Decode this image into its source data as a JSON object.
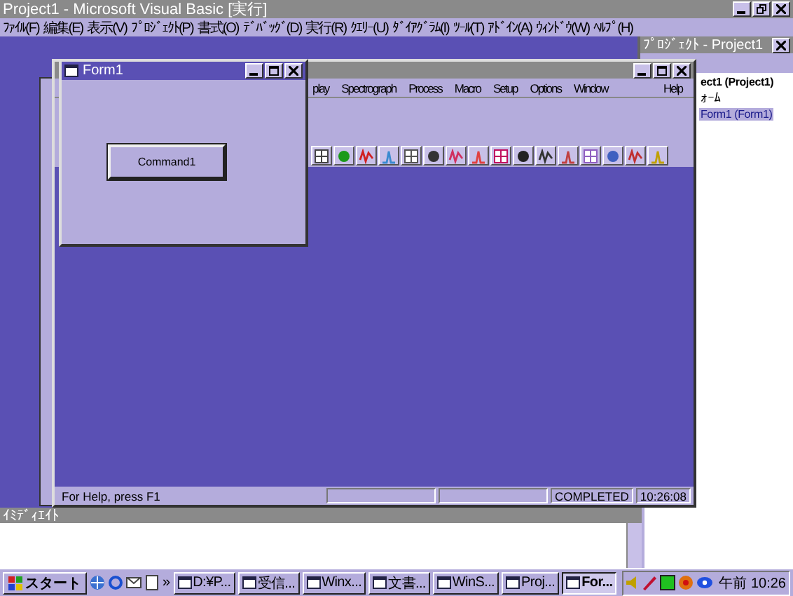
{
  "main_window": {
    "title": "Project1 - Microsoft Visual Basic [実行]",
    "menu": [
      "ﾌｧｲﾙ(F)",
      "編集(E)",
      "表示(V)",
      "ﾌﾟﾛｼﾞｪｸﾄ(P)",
      "書式(O)",
      "ﾃﾞﾊﾞｯｸﾞ(D)",
      "実行(R)",
      "ｸｴﾘｰ(U)",
      "ﾀﾞｲｱｸﾞﾗﾑ(I)",
      "ﾂｰﾙ(T)",
      "ｱﾄﾞｲﾝ(A)",
      "ｳｨﾝﾄﾞｳ(W)",
      "ﾍﾙﾌﾟ(H)"
    ]
  },
  "project_explorer": {
    "title": "ﾌﾟﾛｼﾞｪｸﾄ - Project1",
    "tree": [
      {
        "label": "ect1 (Project1)",
        "selected": false,
        "children": [
          {
            "label": "ｫｰﾑ",
            "selected": false,
            "children": [
              {
                "label": "Form1 (Form1)",
                "selected": true
              }
            ]
          }
        ]
      }
    ]
  },
  "app_window": {
    "menu": [
      "play",
      "Spectrograph",
      "Process",
      "Macro",
      "Setup",
      "Options",
      "Window"
    ],
    "help_menu": "Help",
    "status_bar": [
      "For Help, press F1",
      "COMPLETED",
      "10:26:08"
    ]
  },
  "form1": {
    "title": "Form1",
    "button": "Command1"
  },
  "immediate_window": {
    "title": "ｲﾐﾃﾞｨｴｲﾄ"
  },
  "taskbar": {
    "start": "スタート",
    "more": "»",
    "tasks": [
      {
        "label": "D:¥P...",
        "selected": false
      },
      {
        "label": "受信...",
        "selected": false
      },
      {
        "label": "Winx...",
        "selected": false
      },
      {
        "label": "文書...",
        "selected": false
      },
      {
        "label": "WinS...",
        "selected": false
      },
      {
        "label": "Proj...",
        "selected": false
      },
      {
        "label": "For...",
        "selected": true
      }
    ],
    "clock": "午前 10:26"
  }
}
